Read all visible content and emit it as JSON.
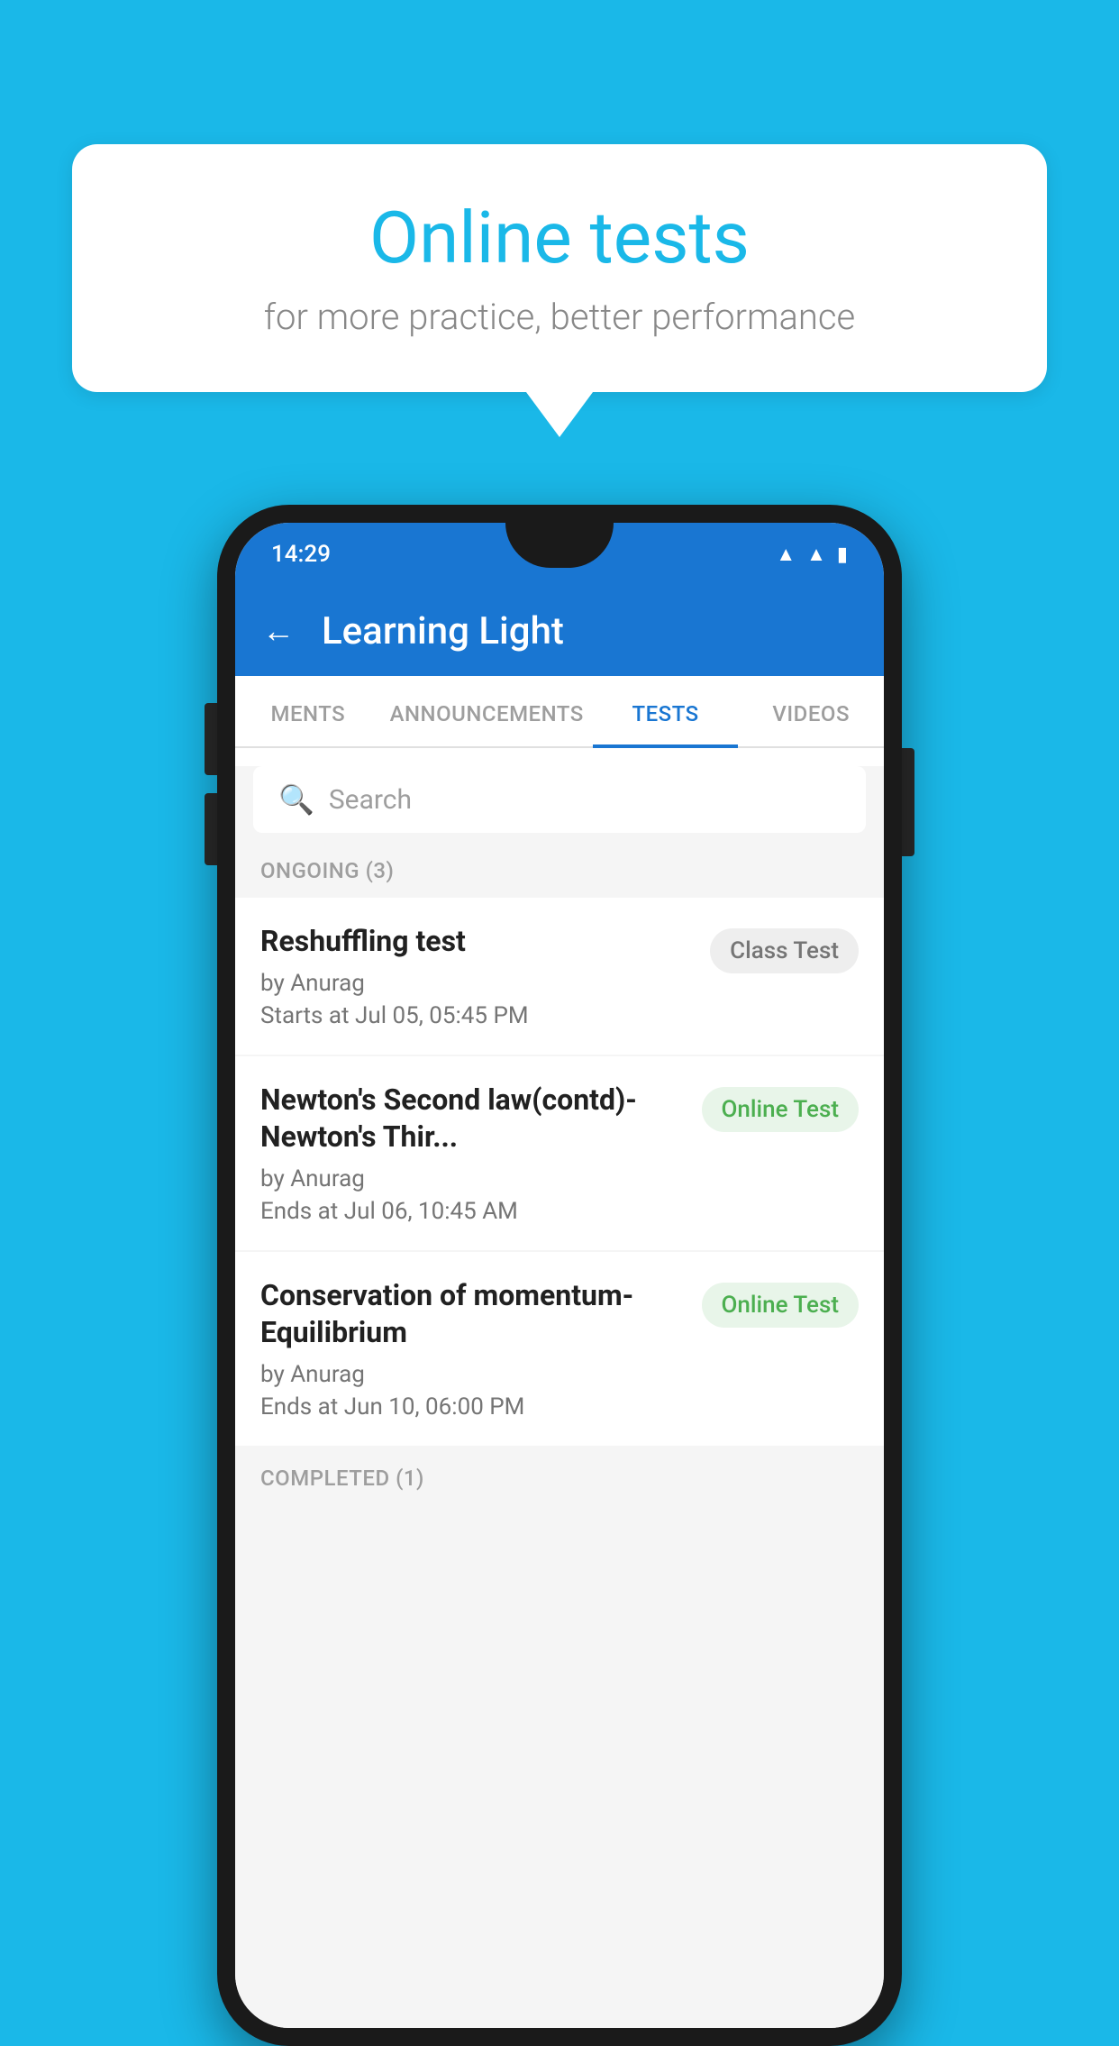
{
  "background_color": "#1ab8e8",
  "bubble": {
    "title": "Online tests",
    "subtitle": "for more practice, better performance"
  },
  "phone": {
    "status_bar": {
      "time": "14:29",
      "icons": [
        "wifi",
        "signal",
        "battery"
      ]
    },
    "app_bar": {
      "title": "Learning Light",
      "back_label": "←"
    },
    "tabs": [
      {
        "label": "MENTS",
        "active": false
      },
      {
        "label": "ANNOUNCEMENTS",
        "active": false
      },
      {
        "label": "TESTS",
        "active": true
      },
      {
        "label": "VIDEOS",
        "active": false
      }
    ],
    "search": {
      "placeholder": "Search"
    },
    "section_ongoing": {
      "label": "ONGOING (3)"
    },
    "test_items": [
      {
        "name": "Reshuffling test",
        "by": "by Anurag",
        "time_label": "Starts at",
        "time": "Jul 05, 05:45 PM",
        "badge": "Class Test",
        "badge_type": "class"
      },
      {
        "name": "Newton's Second law(contd)-Newton's Thir...",
        "by": "by Anurag",
        "time_label": "Ends at",
        "time": "Jul 06, 10:45 AM",
        "badge": "Online Test",
        "badge_type": "online"
      },
      {
        "name": "Conservation of momentum-Equilibrium",
        "by": "by Anurag",
        "time_label": "Ends at",
        "time": "Jun 10, 06:00 PM",
        "badge": "Online Test",
        "badge_type": "online"
      }
    ],
    "section_completed": {
      "label": "COMPLETED (1)"
    }
  }
}
